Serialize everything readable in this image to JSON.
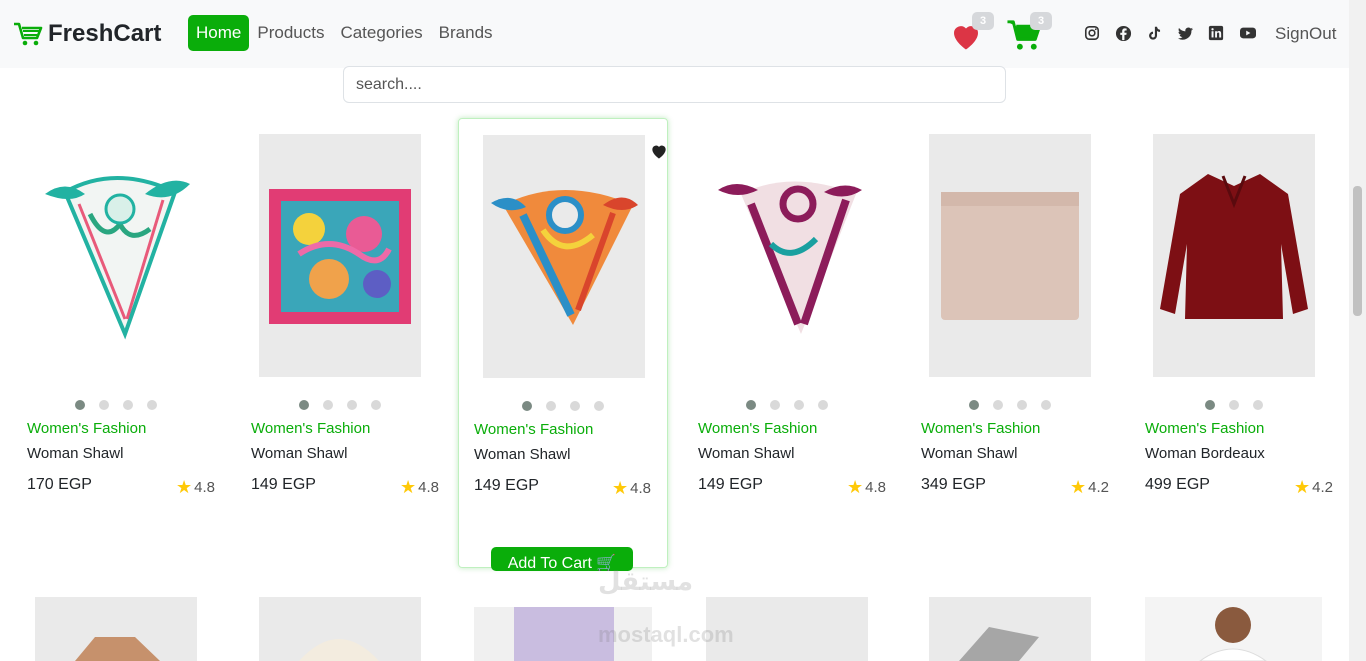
{
  "brand": {
    "name": "FreshCart"
  },
  "nav": {
    "links": [
      "Home",
      "Products",
      "Categories",
      "Brands"
    ],
    "active": "Home"
  },
  "header": {
    "wishlist_count": "3",
    "cart_count": "3",
    "social_icons": [
      "instagram-icon",
      "facebook-icon",
      "tiktok-icon",
      "twitter-icon",
      "linkedin-icon",
      "youtube-icon"
    ],
    "signout_label": "SignOut"
  },
  "search": {
    "placeholder": "search....",
    "value": ""
  },
  "colors": {
    "accent": "#0aad0a",
    "heart": "#dc3545",
    "star": "#ffc908"
  },
  "products": [
    {
      "category": "Women's Fashion",
      "title": "Woman Shawl",
      "price": "170 EGP",
      "rating": "4.8",
      "dots": 4,
      "active_dot": 0
    },
    {
      "category": "Women's Fashion",
      "title": "Woman Shawl",
      "price": "149 EGP",
      "rating": "4.8",
      "dots": 4,
      "active_dot": 0
    },
    {
      "category": "Women's Fashion",
      "title": "Woman Shawl",
      "price": "149 EGP",
      "rating": "4.8",
      "dots": 4,
      "active_dot": 0
    },
    {
      "category": "Women's Fashion",
      "title": "Woman Shawl",
      "price": "149 EGP",
      "rating": "4.8",
      "dots": 4,
      "active_dot": 0
    },
    {
      "category": "Women's Fashion",
      "title": "Woman Shawl",
      "price": "349 EGP",
      "rating": "4.2",
      "dots": 4,
      "active_dot": 0
    },
    {
      "category": "Women's Fashion",
      "title": "Woman Bordeaux",
      "price": "499 EGP",
      "rating": "4.2",
      "dots": 3,
      "active_dot": 0
    }
  ],
  "add_to_cart_label": "Add To Cart",
  "watermark": {
    "line1": "مستقل",
    "line2": "mostaql.com"
  }
}
